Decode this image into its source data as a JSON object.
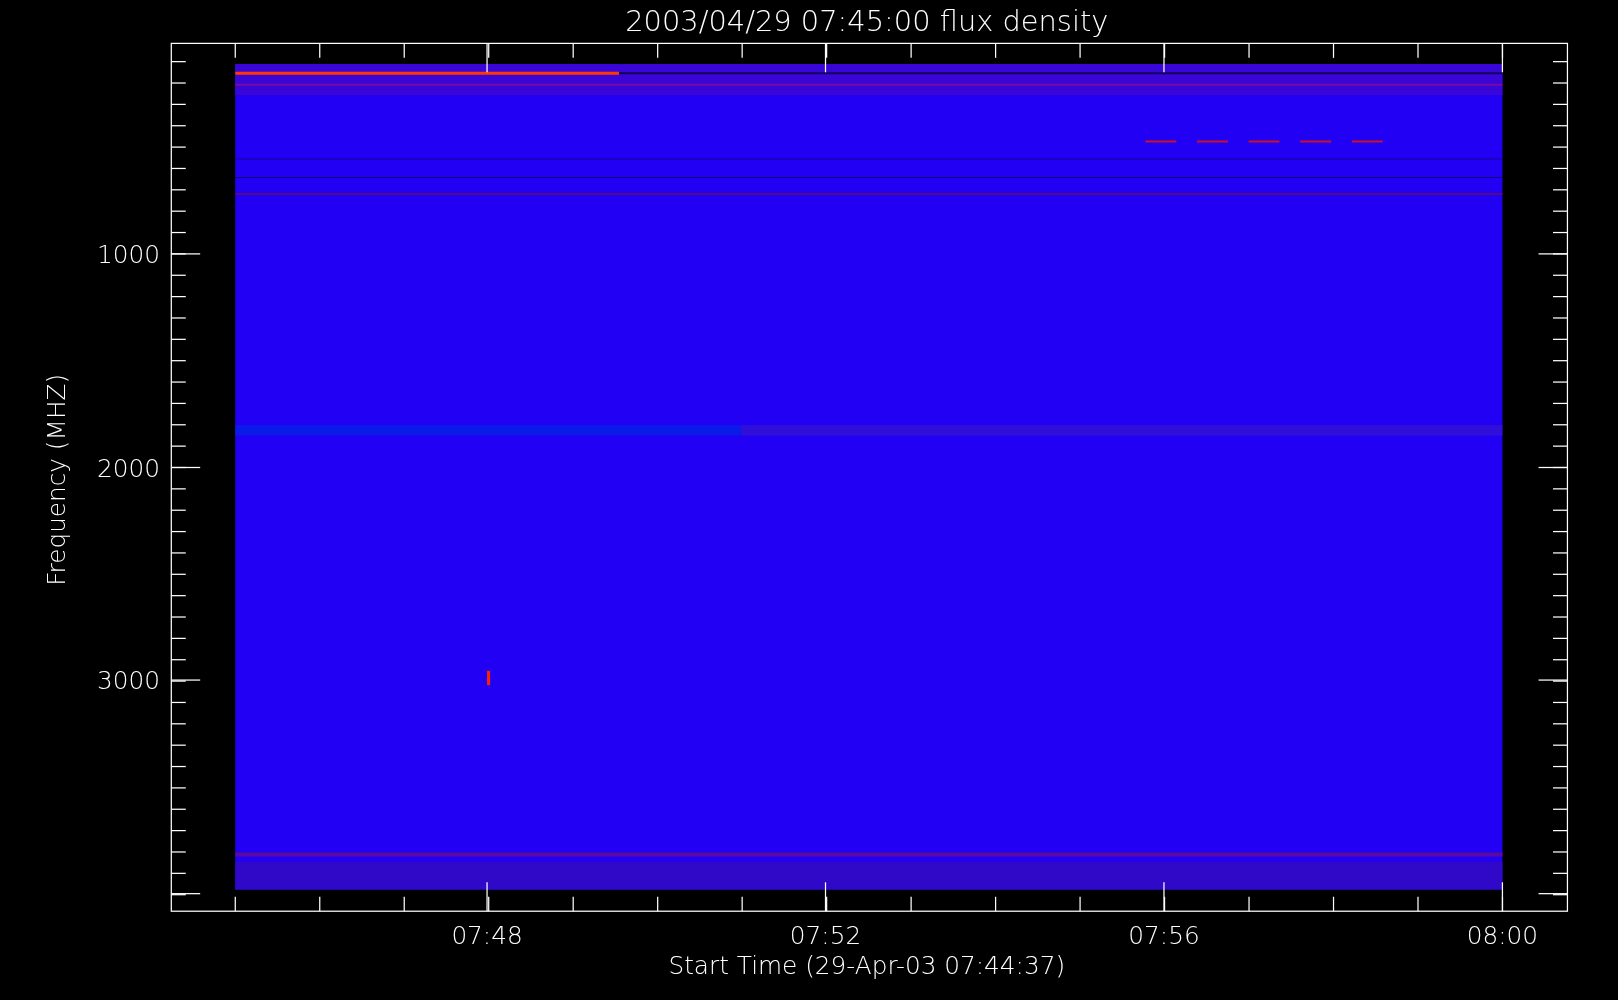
{
  "title": "2003/04/29 07:45:00 flux density",
  "y_axis": {
    "label": "Frequency (MHZ)",
    "tick_labels": [
      "1000",
      "2000",
      "3000"
    ]
  },
  "x_axis": {
    "label": "Start Time (29-Apr-03 07:44:37)",
    "tick_labels": [
      "07:48",
      "07:52",
      "07:56",
      "08:00"
    ]
  }
}
